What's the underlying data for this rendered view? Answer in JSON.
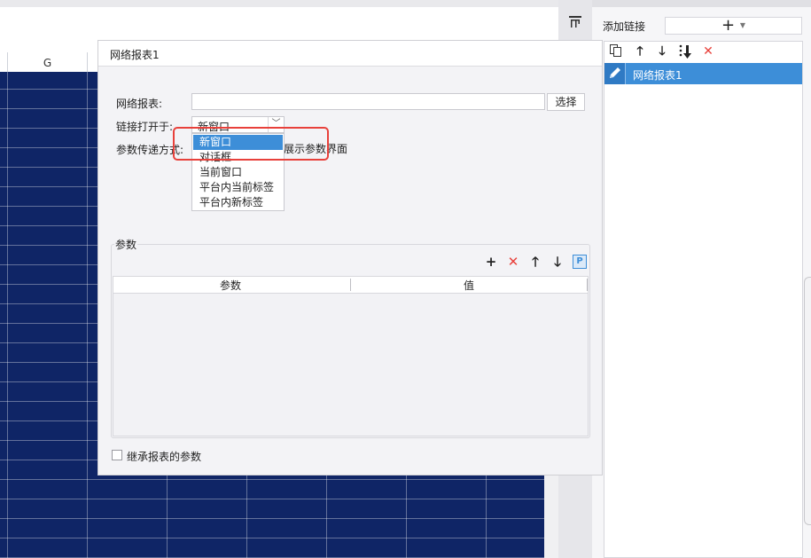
{
  "sheet": {
    "column_header": "G"
  },
  "right_panel": {
    "add_link_label": "添加链接",
    "add_button_symbol": "+",
    "toolbar_icons": [
      "copy-icon",
      "arrow-up-icon",
      "arrow-down-icon",
      "sort-down-icon",
      "delete-icon"
    ],
    "items": [
      {
        "label": "网络报表1",
        "selected": true
      }
    ]
  },
  "dialog": {
    "title": "网络报表1",
    "report_label": "网络报表:",
    "report_value": "",
    "select_button": "选择",
    "open_in_label": "链接打开于:",
    "open_in_value": "新窗口",
    "open_in_options": [
      "新窗口",
      "对话框",
      "当前窗口",
      "平台内当前标签",
      "平台内新标签"
    ],
    "param_pass_label": "参数传递方式:",
    "show_params_text": "展示参数界面",
    "params_section_title": "参数",
    "params_columns": [
      "参数",
      "值"
    ],
    "params_rows": [],
    "inherit_params_label": "继承报表的参数",
    "inherit_params_checked": false
  },
  "colors": {
    "accent": "#3d8ed8",
    "sheet_fill": "#0f2566",
    "highlight": "#e8413b"
  }
}
